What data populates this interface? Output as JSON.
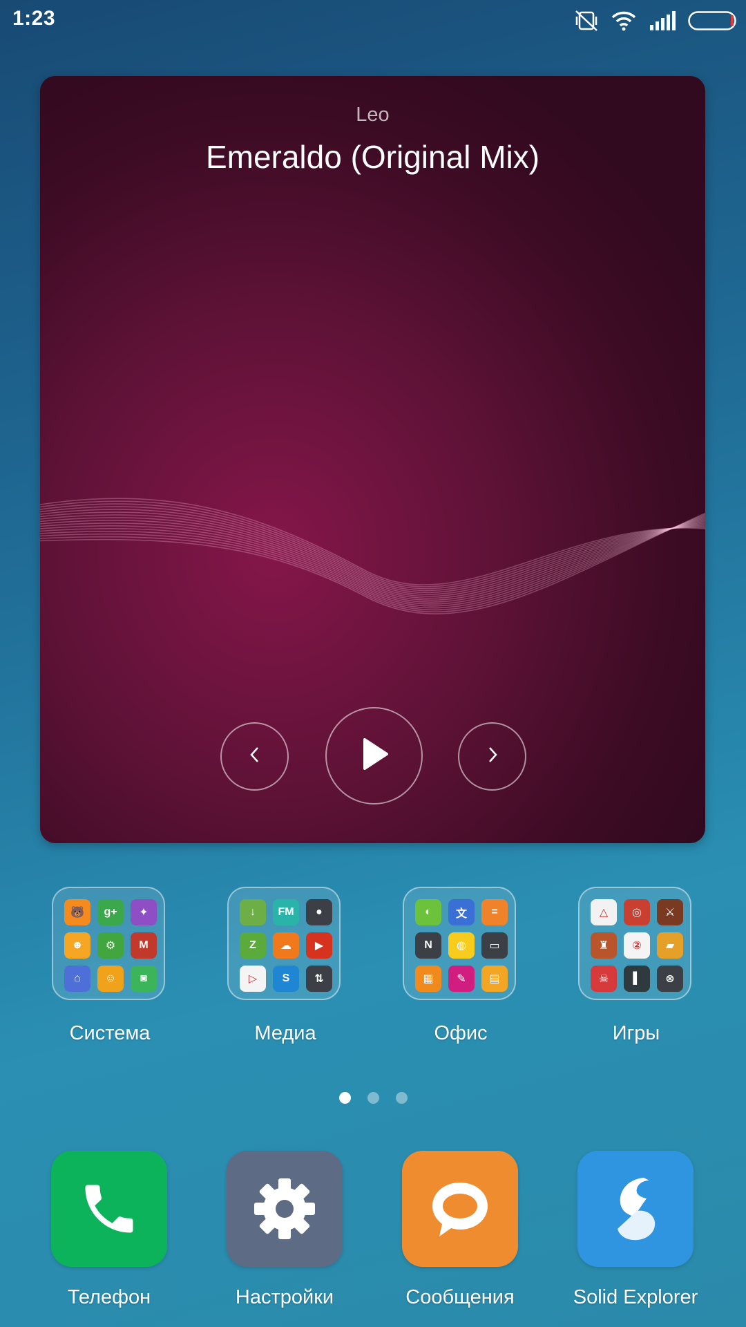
{
  "status_bar": {
    "time": "1:23",
    "icons": [
      "vibrate-off-icon",
      "wifi-icon",
      "signal-icon",
      "battery-icon"
    ]
  },
  "music_widget": {
    "artist": "Leo",
    "title": "Emeraldo (Original Mix)",
    "controls": [
      "previous-icon",
      "play-icon",
      "next-icon"
    ],
    "colors": {
      "background": "#5e1236",
      "accent": "#85164a"
    }
  },
  "folders": [
    {
      "label": "Система",
      "apps": [
        {
          "color": "#f58a1f",
          "glyph": "🐻"
        },
        {
          "color": "#3aa84b",
          "glyph": "g+"
        },
        {
          "color": "#8e4fc4",
          "glyph": "✦"
        },
        {
          "color": "#f5a623",
          "glyph": "☻"
        },
        {
          "color": "#42a63f",
          "glyph": "⚙"
        },
        {
          "color": "#c0392b",
          "glyph": "M"
        },
        {
          "color": "#4f6fd8",
          "glyph": "⌂"
        },
        {
          "color": "#f0a21b",
          "glyph": "☺"
        },
        {
          "color": "#3cb55a",
          "glyph": "◙"
        }
      ]
    },
    {
      "label": "Медиа",
      "apps": [
        {
          "color": "#6dae46",
          "glyph": "↓"
        },
        {
          "color": "#2ab3a8",
          "glyph": "FM"
        },
        {
          "color": "#3c3f46",
          "glyph": "●"
        },
        {
          "color": "#5aaa3c",
          "glyph": "Z"
        },
        {
          "color": "#f07a1b",
          "glyph": "☁"
        },
        {
          "color": "#d6331f",
          "glyph": "▶"
        },
        {
          "color": "#f4f4f4",
          "glyph": "▷"
        },
        {
          "color": "#1f86d4",
          "glyph": "S"
        },
        {
          "color": "#3c3f46",
          "glyph": "⇅"
        }
      ]
    },
    {
      "label": "Офис",
      "apps": [
        {
          "color": "#6cc33b",
          "glyph": "◐"
        },
        {
          "color": "#3a6fd6",
          "glyph": "文"
        },
        {
          "color": "#f0822a",
          "glyph": "="
        },
        {
          "color": "#3c3f46",
          "glyph": "N"
        },
        {
          "color": "#f7cc1d",
          "glyph": "◍"
        },
        {
          "color": "#3c3f46",
          "glyph": "▭"
        },
        {
          "color": "#f08a1c",
          "glyph": "▦"
        },
        {
          "color": "#d21d80",
          "glyph": "✎"
        },
        {
          "color": "#f3a624",
          "glyph": "▤"
        }
      ]
    },
    {
      "label": "Игры",
      "apps": [
        {
          "color": "#f2f2f2",
          "glyph": "△"
        },
        {
          "color": "#c94030",
          "glyph": "◎"
        },
        {
          "color": "#7a3a22",
          "glyph": "⚔"
        },
        {
          "color": "#b8552a",
          "glyph": "♜"
        },
        {
          "color": "#f4f4f4",
          "glyph": "②"
        },
        {
          "color": "#e5a02a",
          "glyph": "▰"
        },
        {
          "color": "#d63a3a",
          "glyph": "☠"
        },
        {
          "color": "#2e3a3e",
          "glyph": "▌"
        },
        {
          "color": "#3c3f46",
          "glyph": "⊗"
        }
      ]
    }
  ],
  "page_indicator": {
    "count": 3,
    "active": 0
  },
  "dock": [
    {
      "label": "Телефон",
      "icon": "phone-icon",
      "color": "#0db35a"
    },
    {
      "label": "Настройки",
      "icon": "settings-gear-icon",
      "color": "#5d6b85"
    },
    {
      "label": "Сообщения",
      "icon": "message-bubble-icon",
      "color": "#f08c30"
    },
    {
      "label": "Solid Explorer",
      "icon": "solid-explorer-icon",
      "color": "#2f95e0"
    }
  ]
}
